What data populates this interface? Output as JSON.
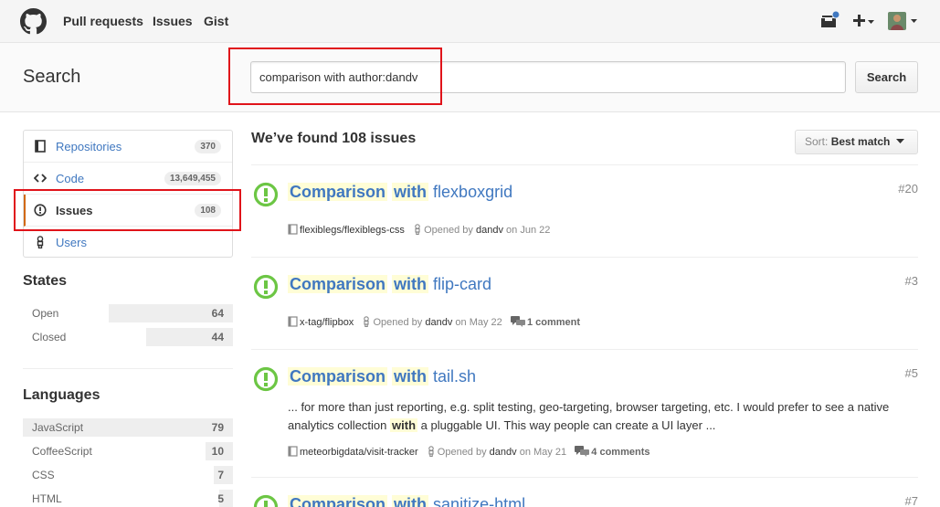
{
  "nav": {
    "pull_requests": "Pull requests",
    "issues": "Issues",
    "gist": "Gist"
  },
  "search": {
    "title": "Search",
    "query": "comparison with author:dandv",
    "button": "Search"
  },
  "menu": [
    {
      "label": "Repositories",
      "count": "370",
      "icon": "repo-icon"
    },
    {
      "label": "Code",
      "count": "13,649,455",
      "icon": "code-icon"
    },
    {
      "label": "Issues",
      "count": "108",
      "icon": "issue-opened-icon",
      "selected": true
    },
    {
      "label": "Users",
      "count": "",
      "icon": "person-icon"
    }
  ],
  "states": {
    "heading": "States",
    "items": [
      {
        "label": "Open",
        "count": "64",
        "fraction": 0.59
      },
      {
        "label": "Closed",
        "count": "44",
        "fraction": 0.41
      }
    ]
  },
  "languages": {
    "heading": "Languages",
    "items": [
      {
        "label": "JavaScript",
        "count": "79",
        "fraction": 1.0
      },
      {
        "label": "CoffeeScript",
        "count": "10",
        "fraction": 0.13
      },
      {
        "label": "CSS",
        "count": "7",
        "fraction": 0.09
      },
      {
        "label": "HTML",
        "count": "5",
        "fraction": 0.06
      }
    ]
  },
  "results_header": {
    "found": "We’ve found 108 issues",
    "sort_label": "Sort:",
    "sort_value": "Best match"
  },
  "results": [
    {
      "hl1": "Comparison",
      "hl2": "with",
      "rest": "flexboxgrid",
      "number": "#20",
      "repo": "flexiblegs/flexiblegs-css",
      "opened_by": "Opened by",
      "author": "dandv",
      "date": "on Jun 22",
      "comments": ""
    },
    {
      "hl1": "Comparison",
      "hl2": "with",
      "rest": "flip-card",
      "number": "#3",
      "repo": "x-tag/flipbox",
      "opened_by": "Opened by",
      "author": "dandv",
      "date": "on May 22",
      "comments_count": "1",
      "comments_word": "comment"
    },
    {
      "hl1": "Comparison",
      "hl2": "with",
      "rest": "tail.sh",
      "number": "#5",
      "body_line1": "... for more than just reporting, e.g. split testing, geo-targeting, browser targeting, etc. I would prefer to see a native",
      "body_line2_pre": "analytics collection",
      "body_line2_hl": "with",
      "body_line2_post": "a pluggable UI. This way people can create a UI layer ...",
      "repo": "meteorbigdata/visit-tracker",
      "opened_by": "Opened by",
      "author": "dandv",
      "date": "on May 21",
      "comments_count": "4",
      "comments_word": "comments"
    },
    {
      "hl1": "Comparison",
      "hl2": "with",
      "rest": "sanitize-html",
      "number": "#7"
    }
  ],
  "colors": {
    "link": "#4078c0",
    "issue_open": "#6cc644",
    "highlight": "#fffdd6",
    "annotation_red": "#e0131a"
  }
}
